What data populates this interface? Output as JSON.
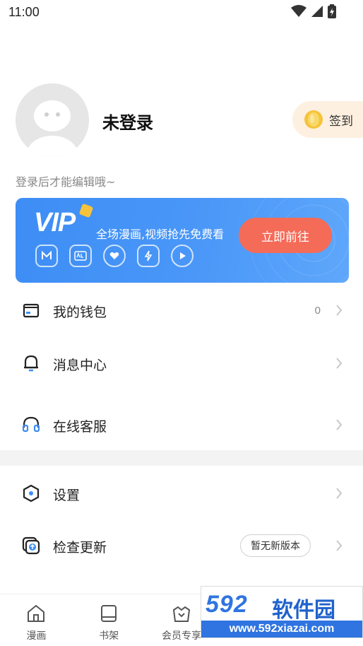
{
  "status_bar": {
    "time": "11:00",
    "icons": [
      "wifi-icon",
      "signal-icon",
      "battery-charging-icon"
    ]
  },
  "profile": {
    "username": "未登录",
    "hint": "登录后才能编辑哦~",
    "checkin_label": "签到"
  },
  "vip": {
    "logo": "VIP",
    "slogan": "全场漫画,视频抢先免费看",
    "button": "立即前往",
    "perk_icons": [
      "m-badge-icon",
      "ad-free-icon",
      "heart-icon",
      "lightning-icon",
      "play-icon"
    ]
  },
  "menu": {
    "wallet": {
      "label": "我的钱包",
      "value": "0"
    },
    "messages": {
      "label": "消息中心"
    },
    "support": {
      "label": "在线客服"
    },
    "settings": {
      "label": "设置"
    },
    "update": {
      "label": "检查更新",
      "badge": "暂无新版本"
    }
  },
  "tabbar": {
    "items": [
      {
        "label": "漫画",
        "icon": "home-icon"
      },
      {
        "label": "书架",
        "icon": "bookshelf-icon"
      },
      {
        "label": "会员专享",
        "icon": "vip-crown-icon"
      },
      {
        "label": "",
        "icon": "rank-icon"
      },
      {
        "label": "",
        "icon": "profile-icon"
      }
    ]
  },
  "watermark": {
    "number": "592",
    "brand": "软件园",
    "url": "www.592xiazai.com"
  },
  "colors": {
    "accent_blue": "#3d8df5",
    "vip_button": "#f46b58",
    "checkin_bg": "#fdf0e0",
    "watermark_blue": "#2f74e0"
  }
}
